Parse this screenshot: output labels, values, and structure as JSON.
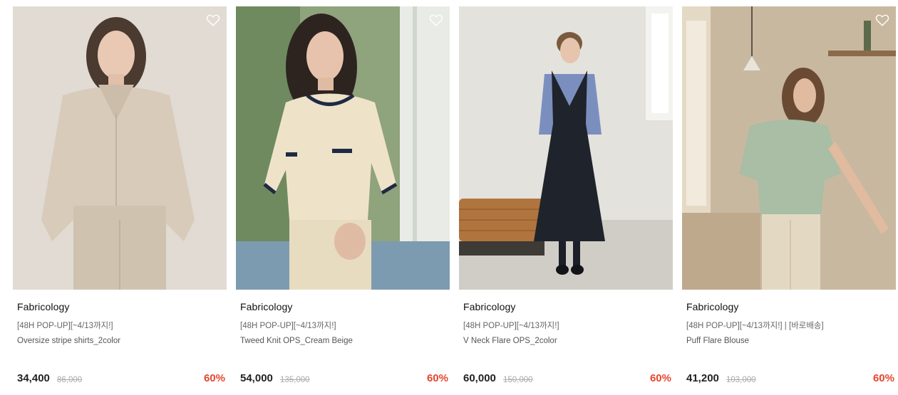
{
  "colors": {
    "discount": "#e8452c",
    "brand_text": "#111111",
    "muted": "#666666"
  },
  "products": [
    {
      "brand": "Fabricology",
      "promo": "[48H POP-UP][~4/13까지!]",
      "name": "Oversize stripe shirts_2color",
      "price": "34,400",
      "original_price": "86,000",
      "discount": "60%"
    },
    {
      "brand": "Fabricology",
      "promo": "[48H POP-UP][~4/13까지!]",
      "name": "Tweed Knit OPS_Cream Beige",
      "price": "54,000",
      "original_price": "135,000",
      "discount": "60%"
    },
    {
      "brand": "Fabricology",
      "promo": "[48H POP-UP][~4/13까지!]",
      "name": "V Neck Flare OPS_2color",
      "price": "60,000",
      "original_price": "150,000",
      "discount": "60%"
    },
    {
      "brand": "Fabricology",
      "promo": "[48H POP-UP][~4/13까지!] | [바로배송]",
      "name": "Puff Flare Blouse",
      "price": "41,200",
      "original_price": "103,000",
      "discount": "60%"
    }
  ]
}
